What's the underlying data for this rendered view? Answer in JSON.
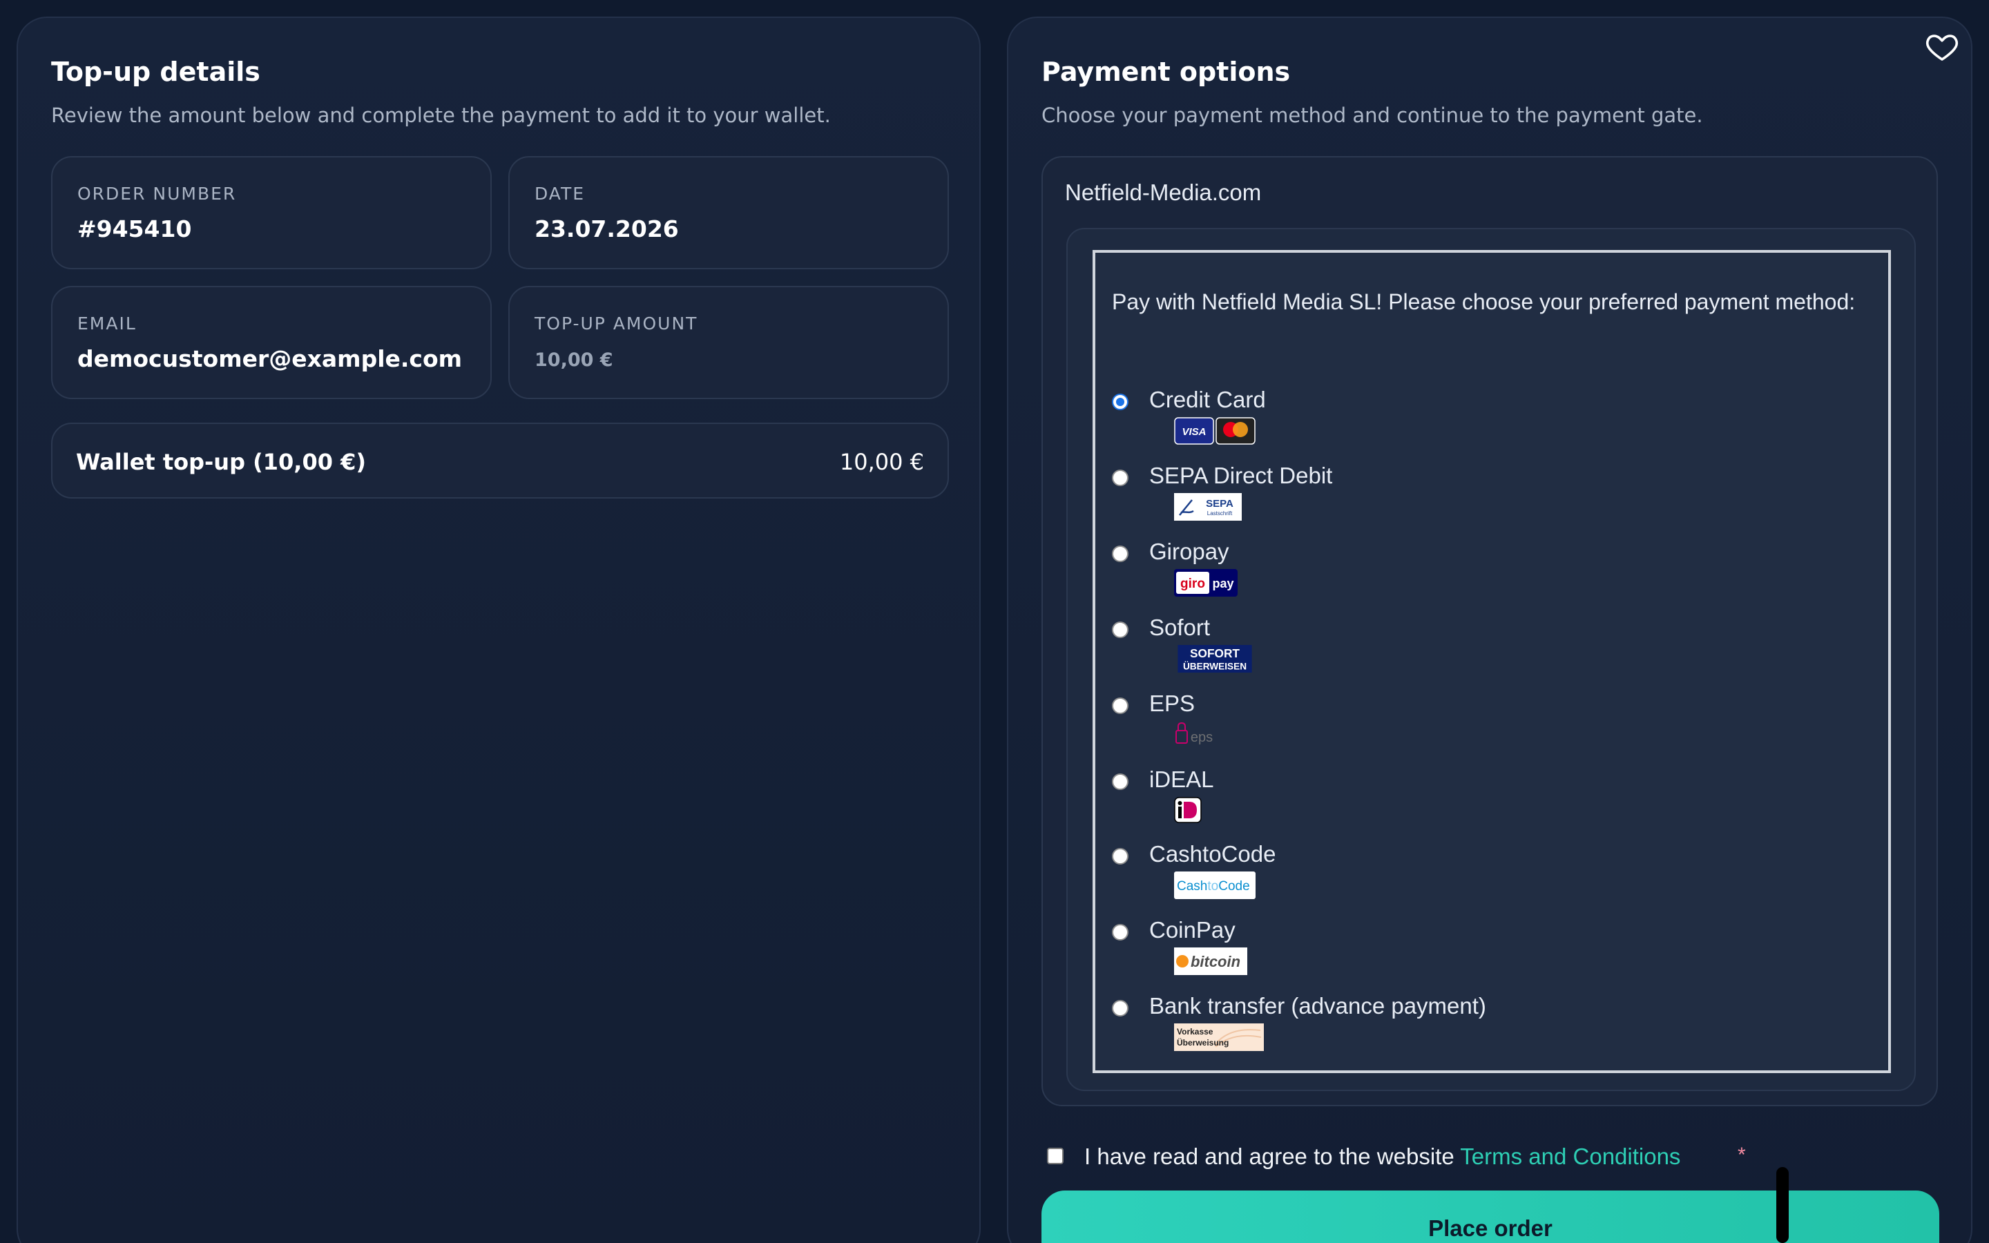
{
  "topup": {
    "title": "Top-up details",
    "subtitle": "Review the amount below and complete the payment to add it to your wallet.",
    "order_number_label": "ORDER NUMBER",
    "order_number": "#945410",
    "date_label": "DATE",
    "date": "23.07.2026",
    "email_label": "EMAIL",
    "email": "democustomer@example.com",
    "amount_label": "TOP-UP AMOUNT",
    "amount": "10,00 €",
    "item_name": "Wallet top-up (10,00 €)",
    "item_price": "10,00 €"
  },
  "payment": {
    "title": "Payment options",
    "subtitle": "Choose your payment method and continue to the payment gate.",
    "site_name": "Netfield-Media.com",
    "intro": "Pay with Netfield Media SL! Please choose your preferred payment method:",
    "methods": [
      {
        "label": "Credit Card",
        "checked": true,
        "icon": "card-logos"
      },
      {
        "label": "SEPA Direct Debit",
        "checked": false,
        "icon": "sepa-logo"
      },
      {
        "label": "Giropay",
        "checked": false,
        "icon": "giropay-logo"
      },
      {
        "label": "Sofort",
        "checked": false,
        "icon": "sofort-logo"
      },
      {
        "label": "EPS",
        "checked": false,
        "icon": "eps-logo"
      },
      {
        "label": "iDEAL",
        "checked": false,
        "icon": "ideal-logo"
      },
      {
        "label": "CashtoCode",
        "checked": false,
        "icon": "cashtocode-logo"
      },
      {
        "label": "CoinPay",
        "checked": false,
        "icon": "bitcoin-logo"
      },
      {
        "label": "Bank transfer (advance payment)",
        "checked": false,
        "icon": "vorkasse-logo"
      }
    ],
    "logos": {
      "visa": "VISA",
      "sepa": "SEPA",
      "sepa_sub": "Lastschrift",
      "giro": "giro",
      "pay": "pay",
      "sofort": "SOFORT",
      "sofort_sub": "ÜBERWEISEN",
      "eps": "eps",
      "cash": "Cash",
      "to": "to",
      "code": "Code",
      "bitcoin": "bitcoin",
      "vorkasse_1": "Vorkasse",
      "vorkasse_2": "Überweisung"
    },
    "terms_prefix": "I have read and agree to the website ",
    "terms_link": "Terms and Conditions",
    "required_mark": "*",
    "place_order": "Place order"
  },
  "colors": {
    "background": "#0f1a2e",
    "accent": "#2ecfb5",
    "radio_checked": "#1a73e8"
  }
}
